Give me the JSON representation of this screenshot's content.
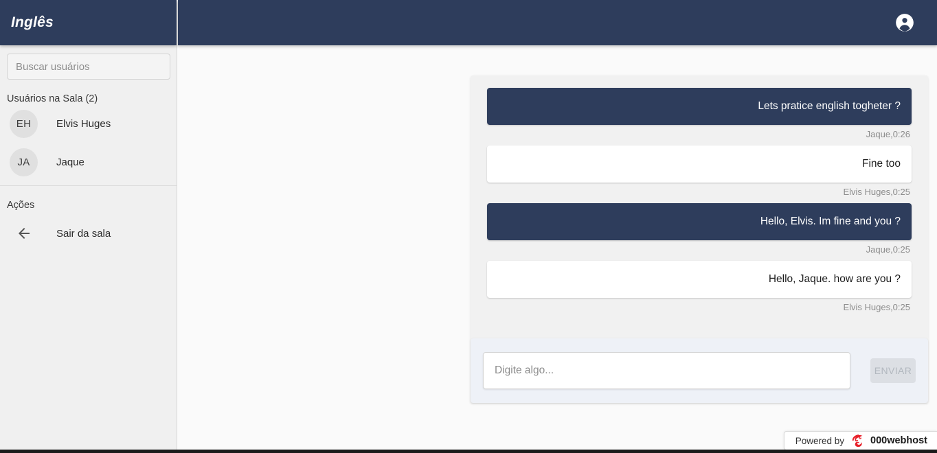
{
  "header": {
    "app_title": "Inglês",
    "account_icon": "account-circle-icon",
    "background_color": "#2e3d5c"
  },
  "sidebar": {
    "search": {
      "placeholder": "Buscar usuários",
      "value": ""
    },
    "users_section_label": "Usuários na Sala (2)",
    "users": [
      {
        "initials": "EH",
        "name": "Elvis Huges"
      },
      {
        "initials": "JA",
        "name": "Jaque"
      }
    ],
    "actions_section_label": "Ações",
    "actions": [
      {
        "icon": "arrow-back-icon",
        "label": "Sair da sala"
      }
    ]
  },
  "chat": {
    "messages": [
      {
        "text": "Lets pratice english togheter ?",
        "meta": "Jaque,0:26",
        "author": "Jaque",
        "time": "0:26",
        "side": "mine"
      },
      {
        "text": "Fine too",
        "meta": "Elvis Huges,0:25",
        "author": "Elvis Huges",
        "time": "0:25",
        "side": "theirs"
      },
      {
        "text": "Hello, Elvis. Im fine and you ?",
        "meta": "Jaque,0:25",
        "author": "Jaque",
        "time": "0:25",
        "side": "mine"
      },
      {
        "text": "Hello, Jaque. how are you ?",
        "meta": "Elvis Huges,0:25",
        "author": "Elvis Huges",
        "time": "0:25",
        "side": "theirs"
      }
    ],
    "composer": {
      "placeholder": "Digite algo...",
      "value": "",
      "send_label": "ENVIAR",
      "send_disabled": true
    },
    "colors": {
      "mine_bubble": "#2e3d5c",
      "theirs_bubble": "#ffffff",
      "panel": "#f1f1f1",
      "composer": "#eef1f7"
    }
  },
  "footer": {
    "powered_by_text": "Powered by",
    "brand": "000webhost",
    "logo_icon": "webhost-flame-icon",
    "logo_color": "#e8202a"
  }
}
